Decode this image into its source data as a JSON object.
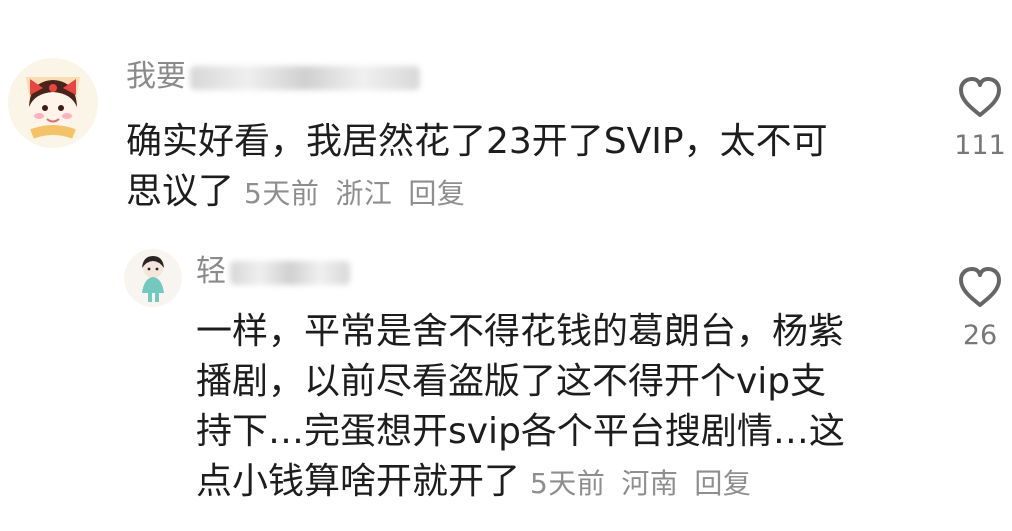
{
  "comments": [
    {
      "username_visible": "我要",
      "text_line1": "确实好看，我居然花了23开了SVIP，太不可",
      "text_line2": "思议了",
      "time": "5天前",
      "location": "浙江",
      "reply_label": "回复",
      "likes": "111",
      "avatar_icon": "girl-with-bow-avatar-icon",
      "like_icon": "heart-outline-icon"
    },
    {
      "username_visible": "轻",
      "text_line1": "一样，平常是舍不得花钱的葛朗台，杨紫",
      "text_line2": "播剧，以前尽看盗版了这不得开个vip支",
      "text_line3": "持下…完蛋想开svip各个平台搜剧情…这",
      "text_line4": "点小钱算啥开就开了",
      "time": "5天前",
      "location": "河南",
      "reply_label": "回复",
      "likes": "26",
      "avatar_icon": "girl-in-teal-outfit-avatar-icon",
      "like_icon": "heart-outline-icon"
    }
  ],
  "colors": {
    "text": "#1d1d1d",
    "secondary": "#8e8e8e",
    "like": "#777777"
  }
}
